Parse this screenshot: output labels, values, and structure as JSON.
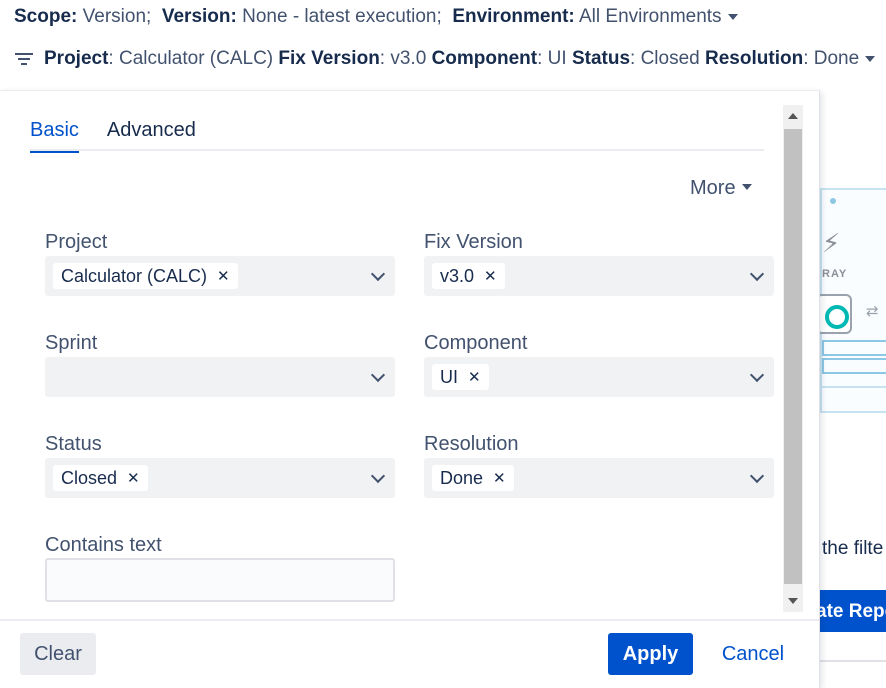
{
  "scope_bar": {
    "scope_label": "Scope:",
    "scope_value": "Version;",
    "version_label": "Version:",
    "version_value": "None - latest execution;",
    "environment_label": "Environment:",
    "environment_value": "All Environments"
  },
  "filter_summary": {
    "project_label": "Project",
    "project_value": ": Calculator (CALC)",
    "fix_version_label": "Fix Version",
    "fix_version_value": ": v3.0",
    "component_label": "Component",
    "component_value": ": UI",
    "status_label": "Status",
    "status_value": ": Closed",
    "resolution_label": "Resolution",
    "resolution_value": ": Done"
  },
  "tabs": [
    {
      "label": "Basic",
      "active": true
    },
    {
      "label": "Advanced",
      "active": false
    }
  ],
  "more_label": "More",
  "fields": {
    "project": {
      "label": "Project",
      "chip": "Calculator (CALC)"
    },
    "fix_version": {
      "label": "Fix Version",
      "chip": "v3.0"
    },
    "sprint": {
      "label": "Sprint"
    },
    "component": {
      "label": "Component",
      "chip": "UI"
    },
    "status": {
      "label": "Status",
      "chip": "Closed"
    },
    "resolution": {
      "label": "Resolution",
      "chip": "Done"
    },
    "contains_text": {
      "label": "Contains text",
      "value": ""
    }
  },
  "chip_remove_glyph": "✕",
  "footer": {
    "clear_label": "Clear",
    "apply_label": "Apply",
    "cancel_label": "Cancel"
  },
  "background": {
    "brand_text": "RAY",
    "partial_text": "the filte",
    "partial_button": "ate Repo"
  },
  "colors": {
    "accent": "#0052cc",
    "field_bg": "#f1f2f4",
    "text": "#172b4d",
    "muted": "#42526e"
  }
}
